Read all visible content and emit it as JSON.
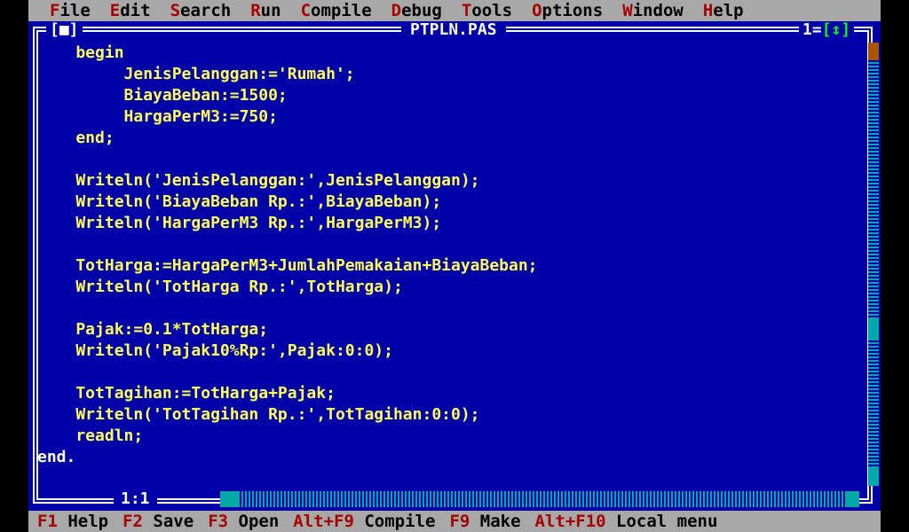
{
  "menu": [
    {
      "hot": "F",
      "rest": "ile"
    },
    {
      "hot": "E",
      "rest": "dit"
    },
    {
      "hot": "S",
      "rest": "earch"
    },
    {
      "hot": "R",
      "rest": "un"
    },
    {
      "hot": "C",
      "rest": "ompile"
    },
    {
      "hot": "D",
      "rest": "ebug"
    },
    {
      "hot": "T",
      "rest": "ools"
    },
    {
      "hot": "O",
      "rest": "ptions"
    },
    {
      "hot": "W",
      "rest": "indow"
    },
    {
      "hot": "H",
      "rest": "elp"
    }
  ],
  "window": {
    "title": "PTPLN.PAS",
    "close_box": "[■]",
    "number": "1=",
    "zoom_box": "[↕]",
    "cursor_pos": "1:1"
  },
  "code_lines": [
    "    begin",
    "         JenisPelanggan:='Rumah';",
    "         BiayaBeban:=1500;",
    "         HargaPerM3:=750;",
    "    end;",
    "",
    "    Writeln('JenisPelanggan:',JenisPelanggan);",
    "    Writeln('BiayaBeban Rp.:',BiayaBeban);",
    "    Writeln('HargaPerM3 Rp.:',HargaPerM3);",
    "",
    "    TotHarga:=HargaPerM3+JumlahPemakaian+BiayaBeban;",
    "    Writeln('TotHarga Rp.:',TotHarga);",
    "",
    "    Pajak:=0.1*TotHarga;",
    "    Writeln('Pajak10%Rp:',Pajak:0:0);",
    "",
    "    TotTagihan:=TotHarga+Pajak;",
    "    Writeln('TotTagihan Rp.:',TotTagihan:0:0);",
    "    readln;",
    "end."
  ],
  "status": [
    {
      "key": "F1",
      "label": " Help"
    },
    {
      "key": "F2",
      "label": " Save"
    },
    {
      "key": "F3",
      "label": " Open"
    },
    {
      "key": "Alt+F9",
      "label": " Compile"
    },
    {
      "key": "F9",
      "label": " Make"
    },
    {
      "key": "Alt+F10",
      "label": " Local menu"
    }
  ],
  "colors": {
    "editor_bg": "#0000a8",
    "code_text": "#ffff55",
    "menu_bg": "#a8a8a8",
    "hotkey": "#a80000"
  }
}
